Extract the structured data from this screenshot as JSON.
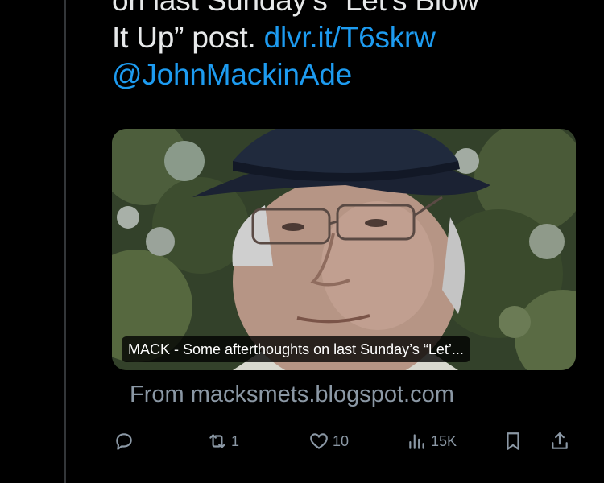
{
  "tweet": {
    "text_line1": "on last Sunday’s “Let’s Blow",
    "text_line2_prefix": "It Up” post. ",
    "link": "dlvr.it/T6skrw",
    "mention": "@JohnMackinAde"
  },
  "card": {
    "caption": "MACK - Some afterthoughts on last Sunday’s “Let’...",
    "source": "From macksmets.blogspot.com"
  },
  "actions": {
    "reply_icon": "reply-icon",
    "retweet_count": "1",
    "like_count": "10",
    "views_count": "15K"
  },
  "colors": {
    "background": "#000000",
    "text": "#e7e9ea",
    "link": "#1d9bf0",
    "muted": "#8b98a5"
  }
}
